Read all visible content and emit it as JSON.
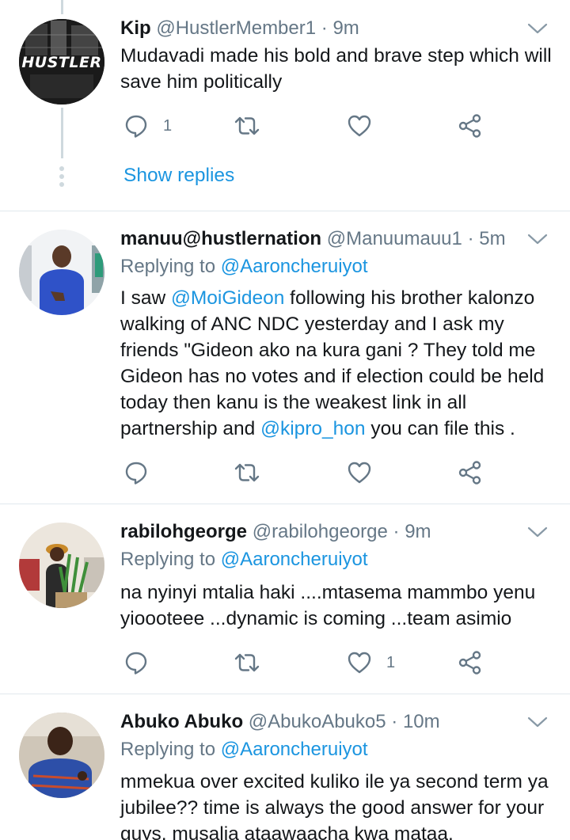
{
  "colors": {
    "accent": "#1b95e0",
    "muted": "#657786",
    "text": "#14171a",
    "divider": "#e1e8ed"
  },
  "tweets": [
    {
      "name": "Kip",
      "handle": "@HustlerMember1",
      "sep": "·",
      "time": "9m",
      "avatar_text": "HUSTLER",
      "body": "Mudavadi made his bold and brave step which will save him politically",
      "reply_count": "1",
      "like_count": "",
      "show_replies": "Show replies"
    },
    {
      "name": "manuu@hustlernation",
      "handle": "@Manuumauu1",
      "sep": "·",
      "time": "5m",
      "replying_prefix": "Replying to",
      "replying_to": "@Aaroncheruiyot",
      "body_parts": [
        "I saw ",
        "@MoiGideon",
        " following his brother kalonzo walking of ANC NDC yesterday and I ask my friends \"Gideon ako na kura gani ? They told me Gideon has no votes and if election could be held today then kanu is the weakest link in all partnership and ",
        "@kipro_hon",
        " you can file this ."
      ],
      "reply_count": "",
      "like_count": ""
    },
    {
      "name": "rabilohgeorge",
      "handle": "@rabilohgeorge",
      "sep": "·",
      "time": "9m",
      "replying_prefix": "Replying to",
      "replying_to": "@Aaroncheruiyot",
      "body": "na nyinyi mtalia haki ....mtasema mammbo yenu yioooteee ...dynamic is coming ...team asimio",
      "reply_count": "",
      "like_count": "1"
    },
    {
      "name": "Abuko Abuko",
      "handle": "@AbukoAbuko5",
      "sep": "·",
      "time": "10m",
      "replying_prefix": "Replying to",
      "replying_to": "@Aaroncheruiyot",
      "body": "mmekua over excited kuliko ile ya second term ya jubilee?? time is always the good answer for your guys, musalia ataawaacha kwa mataa."
    }
  ],
  "icons": [
    "reply-icon",
    "retweet-icon",
    "like-icon",
    "share-icon",
    "chevron-down-icon"
  ]
}
